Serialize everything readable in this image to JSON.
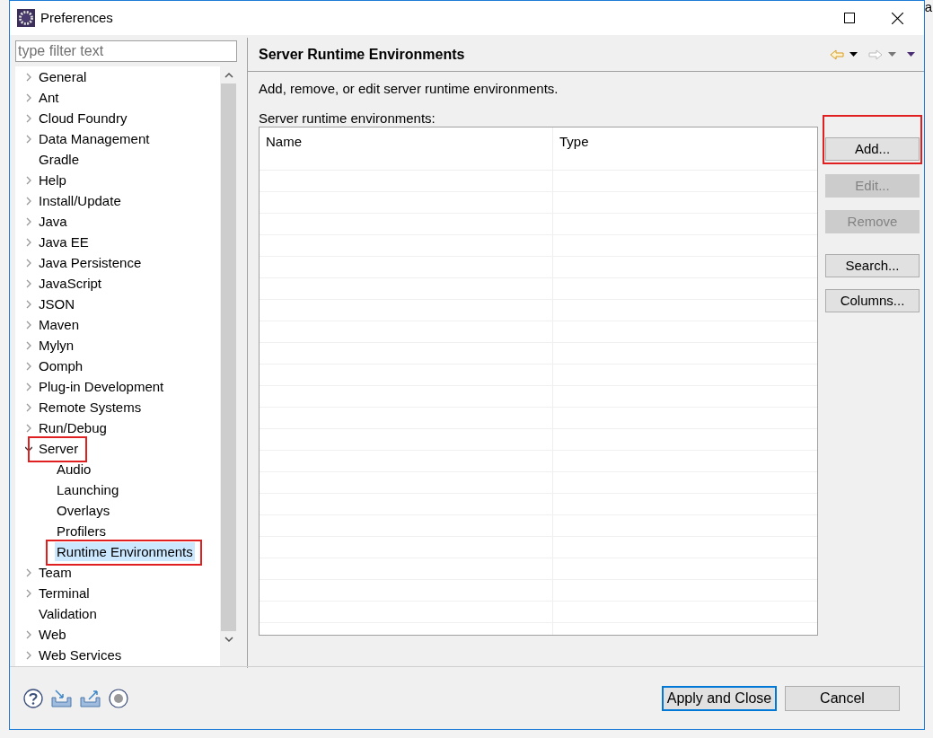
{
  "background_text": "a",
  "window": {
    "title": "Preferences"
  },
  "filter": {
    "placeholder": "type filter text"
  },
  "tree": [
    {
      "label": "General",
      "kind": "folder",
      "expanded": false,
      "selected": false,
      "annotated": false
    },
    {
      "label": "Ant",
      "kind": "folder",
      "expanded": false,
      "selected": false,
      "annotated": false
    },
    {
      "label": "Cloud Foundry",
      "kind": "folder",
      "expanded": false,
      "selected": false,
      "annotated": false
    },
    {
      "label": "Data Management",
      "kind": "folder",
      "expanded": false,
      "selected": false,
      "annotated": false
    },
    {
      "label": "Gradle",
      "kind": "leaf",
      "selected": false,
      "annotated": false
    },
    {
      "label": "Help",
      "kind": "folder",
      "expanded": false,
      "selected": false,
      "annotated": false
    },
    {
      "label": "Install/Update",
      "kind": "folder",
      "expanded": false,
      "selected": false,
      "annotated": false
    },
    {
      "label": "Java",
      "kind": "folder",
      "expanded": false,
      "selected": false,
      "annotated": false
    },
    {
      "label": "Java EE",
      "kind": "folder",
      "expanded": false,
      "selected": false,
      "annotated": false
    },
    {
      "label": "Java Persistence",
      "kind": "folder",
      "expanded": false,
      "selected": false,
      "annotated": false
    },
    {
      "label": "JavaScript",
      "kind": "folder",
      "expanded": false,
      "selected": false,
      "annotated": false
    },
    {
      "label": "JSON",
      "kind": "folder",
      "expanded": false,
      "selected": false,
      "annotated": false
    },
    {
      "label": "Maven",
      "kind": "folder",
      "expanded": false,
      "selected": false,
      "annotated": false
    },
    {
      "label": "Mylyn",
      "kind": "folder",
      "expanded": false,
      "selected": false,
      "annotated": false
    },
    {
      "label": "Oomph",
      "kind": "folder",
      "expanded": false,
      "selected": false,
      "annotated": false
    },
    {
      "label": "Plug-in Development",
      "kind": "folder",
      "expanded": false,
      "selected": false,
      "annotated": false
    },
    {
      "label": "Remote Systems",
      "kind": "folder",
      "expanded": false,
      "selected": false,
      "annotated": false
    },
    {
      "label": "Run/Debug",
      "kind": "folder",
      "expanded": false,
      "selected": false,
      "annotated": false
    },
    {
      "label": "Server",
      "kind": "folder",
      "expanded": true,
      "selected": false,
      "annotated": true,
      "children": [
        {
          "label": "Audio",
          "selected": false,
          "annotated": false
        },
        {
          "label": "Launching",
          "selected": false,
          "annotated": false
        },
        {
          "label": "Overlays",
          "selected": false,
          "annotated": false
        },
        {
          "label": "Profilers",
          "selected": false,
          "annotated": false
        },
        {
          "label": "Runtime Environments",
          "selected": true,
          "annotated": true
        }
      ]
    },
    {
      "label": "Team",
      "kind": "folder",
      "expanded": false,
      "selected": false,
      "annotated": false
    },
    {
      "label": "Terminal",
      "kind": "folder",
      "expanded": false,
      "selected": false,
      "annotated": false
    },
    {
      "label": "Validation",
      "kind": "leaf",
      "selected": false,
      "annotated": false
    },
    {
      "label": "Web",
      "kind": "folder",
      "expanded": false,
      "selected": false,
      "annotated": false
    },
    {
      "label": "Web Services",
      "kind": "folder",
      "expanded": false,
      "selected": false,
      "annotated": false
    }
  ],
  "page": {
    "title": "Server Runtime Environments",
    "description": "Add, remove, or edit server runtime environments.",
    "table_label": "Server runtime environments:"
  },
  "table": {
    "columns": [
      "Name",
      "Type"
    ]
  },
  "side_buttons": [
    {
      "label": "Add...",
      "disabled": false,
      "annotated": true
    },
    {
      "label": "Edit...",
      "disabled": true,
      "annotated": false
    },
    {
      "label": "Remove",
      "disabled": true,
      "annotated": false
    },
    {
      "label": "Search...",
      "disabled": false,
      "annotated": false
    },
    {
      "label": "Columns...",
      "disabled": false,
      "annotated": false
    }
  ],
  "footer_buttons": [
    {
      "label": "Apply and Close",
      "default": true
    },
    {
      "label": "Cancel",
      "default": false
    }
  ]
}
